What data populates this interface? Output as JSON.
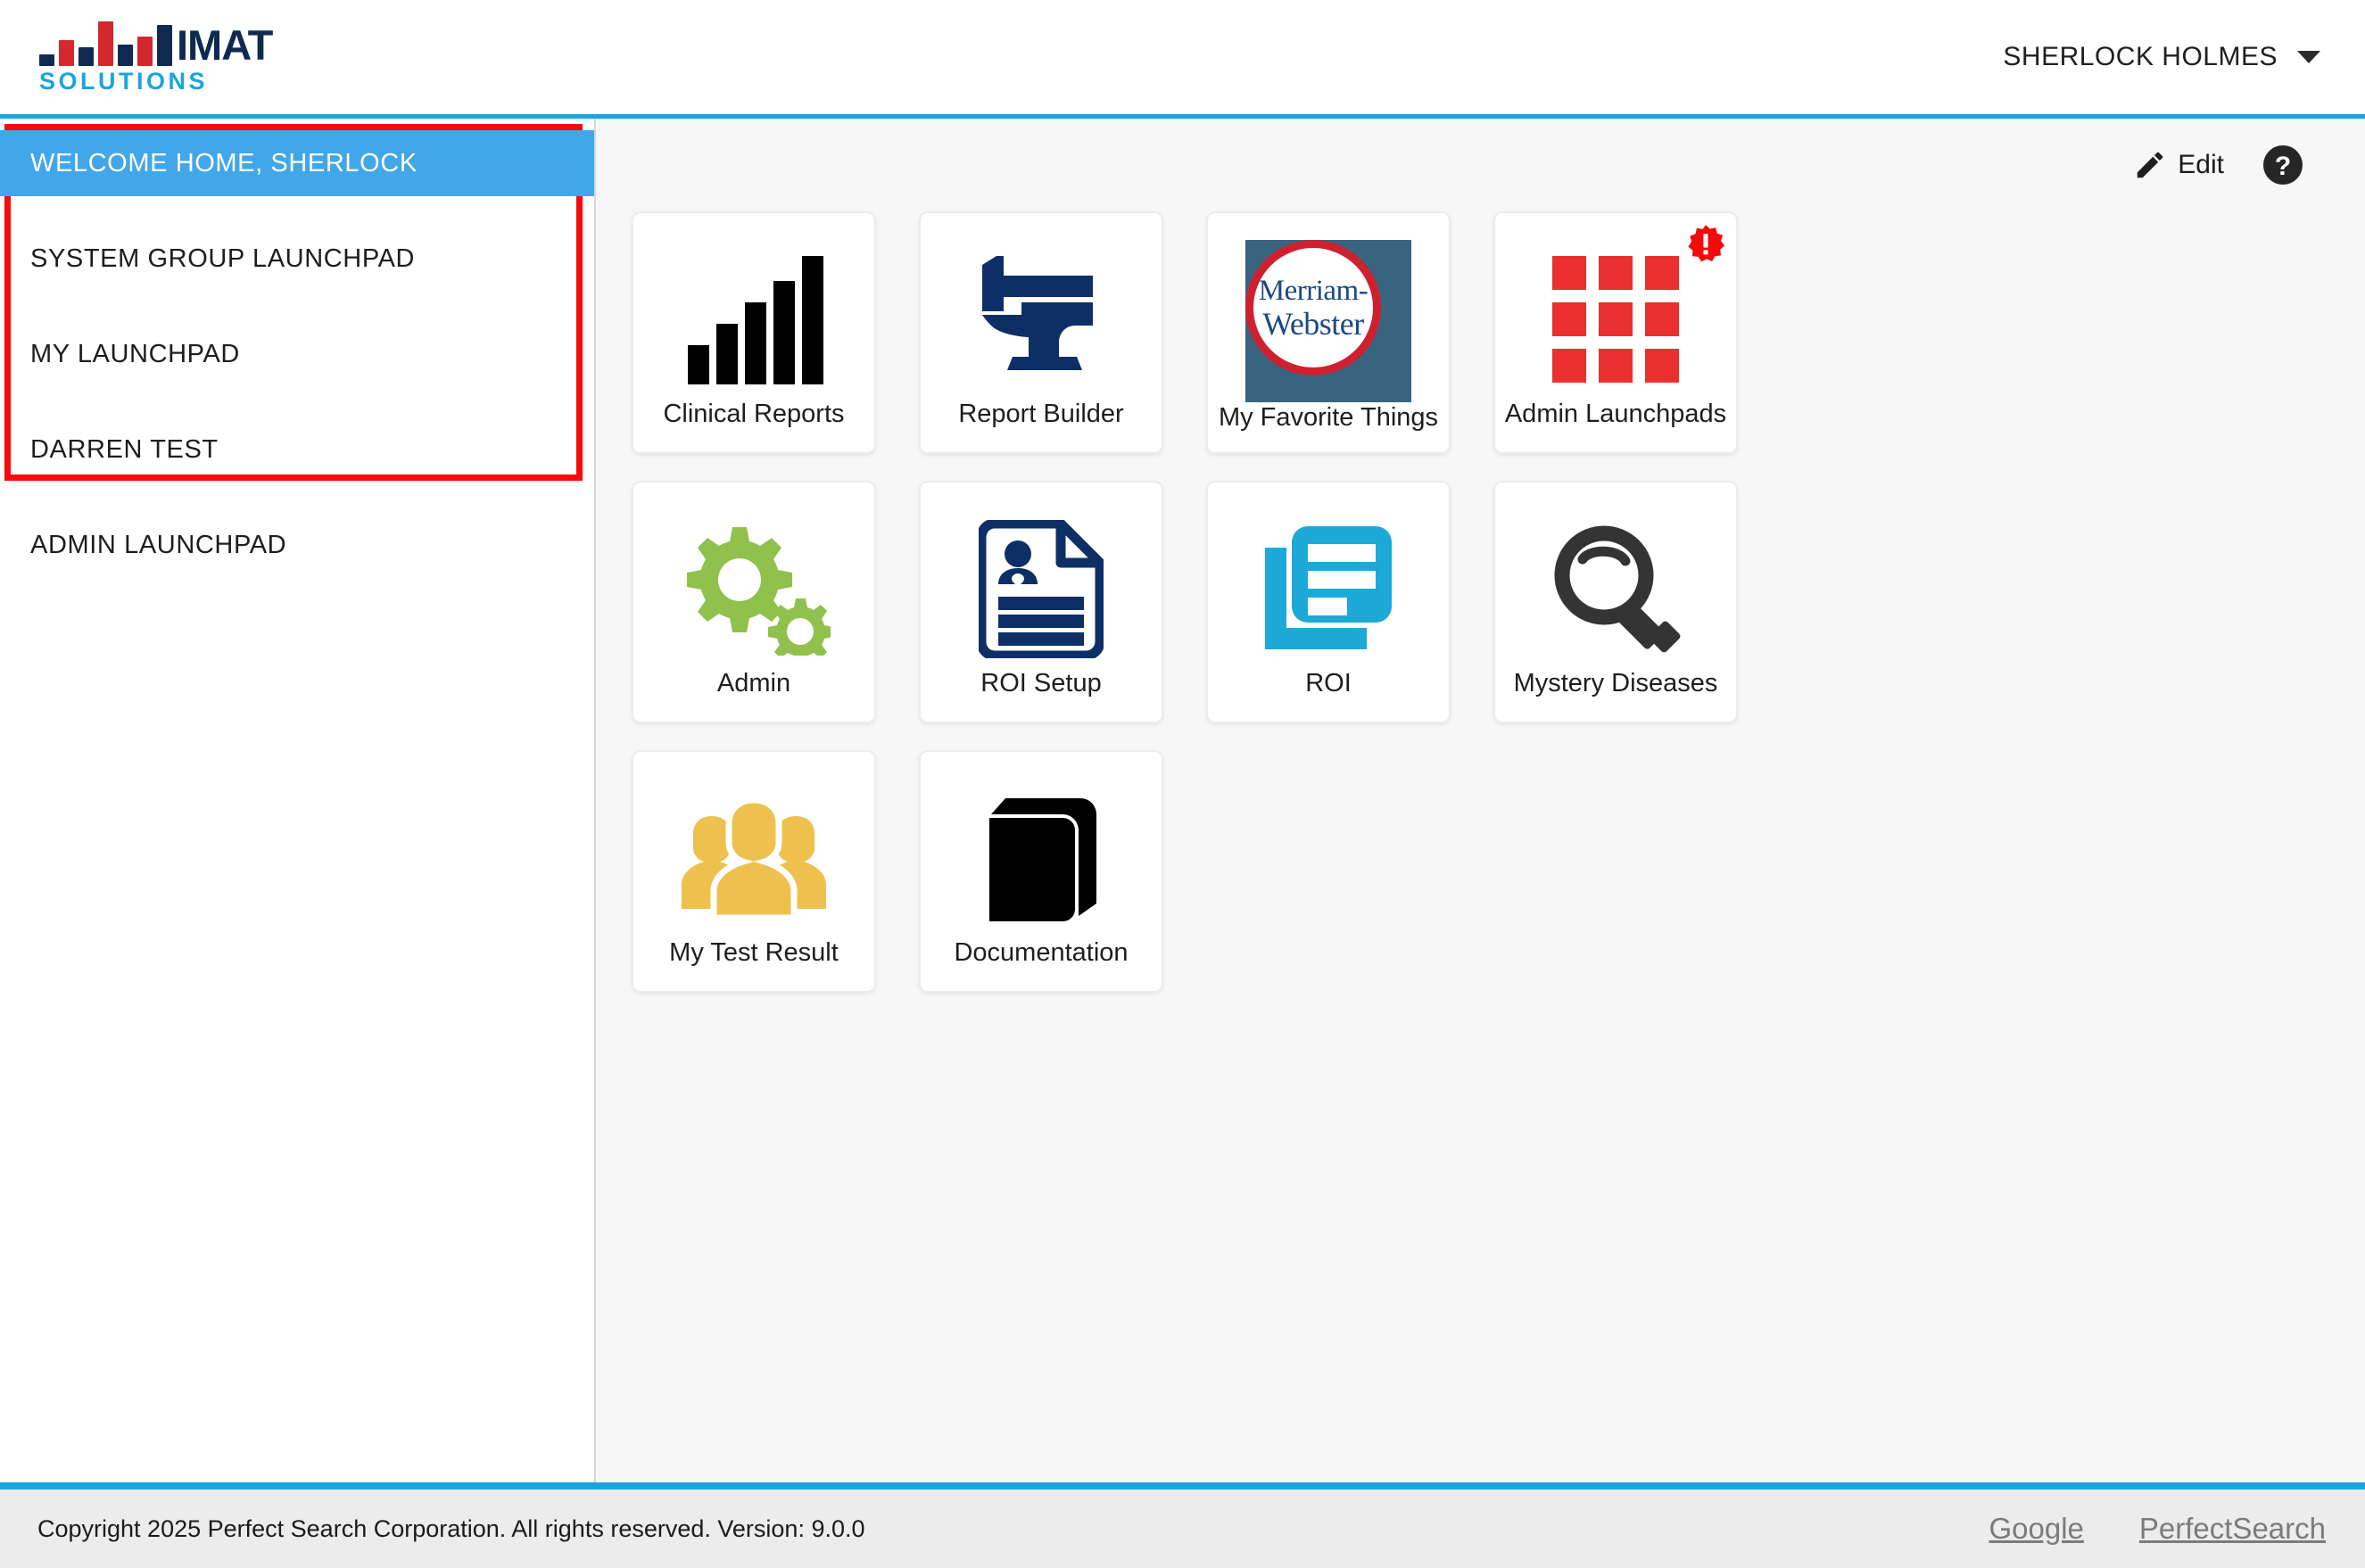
{
  "brand": {
    "name_primary": "IMAT",
    "name_secondary": "SOLUTIONS",
    "bar_colors": [
      "#0e2a50",
      "#d2282e",
      "#0e2a50",
      "#d2282e",
      "#0e2a50",
      "#d2282e",
      "#0e2a50"
    ],
    "accent_blue": "#1ba4de",
    "navy": "#0e2a50",
    "red": "#d2282e"
  },
  "header": {
    "user_name": "SHERLOCK HOLMES",
    "caret_icon": "chevron-down-icon"
  },
  "sidebar": {
    "highlight_outline_color": "#f60c0c",
    "active_color": "#42a7e8",
    "items": [
      {
        "label": "WELCOME HOME, SHERLOCK",
        "active": true
      },
      {
        "label": "SYSTEM GROUP LAUNCHPAD",
        "active": false
      },
      {
        "label": "MY LAUNCHPAD",
        "active": false
      },
      {
        "label": "DARREN TEST",
        "active": false
      },
      {
        "label": "ADMIN LAUNCHPAD",
        "active": false
      }
    ]
  },
  "toolbar": {
    "edit_label": "Edit",
    "edit_icon": "pencil-icon",
    "help_icon": "help-circle-icon"
  },
  "tiles": [
    {
      "label": "Clinical Reports",
      "icon": "bar-chart-icon",
      "badge": false,
      "color": "#000000"
    },
    {
      "label": "Report Builder",
      "icon": "anvil-hammer-icon",
      "badge": false,
      "color": "#0d2f66"
    },
    {
      "label": "My Favorite Things",
      "icon": "merriam-webster-logo",
      "badge": false,
      "color": "#39647f"
    },
    {
      "label": "Admin Launchpads",
      "icon": "grid-nine-squares-icon",
      "badge": true,
      "color": "#ea2f2f"
    },
    {
      "label": "Admin",
      "icon": "gears-icon",
      "badge": false,
      "color": "#90c14d"
    },
    {
      "label": "ROI Setup",
      "icon": "document-person-icon",
      "badge": false,
      "color": "#0d2f66"
    },
    {
      "label": "ROI",
      "icon": "stacked-documents-icon",
      "badge": false,
      "color": "#1ca9d8"
    },
    {
      "label": "Mystery Diseases",
      "icon": "magnifier-icon",
      "badge": false,
      "color": "#343434"
    },
    {
      "label": "My Test Result",
      "icon": "people-group-icon",
      "badge": false,
      "color": "#eec14f"
    },
    {
      "label": "Documentation",
      "icon": "book-icon",
      "badge": false,
      "color": "#000000"
    }
  ],
  "badge": {
    "icon": "alert-exclamation-badge-icon",
    "color": "#f50a0a"
  },
  "footer": {
    "copyright": "Copyright 2025 Perfect Search Corporation. All rights reserved. Version: 9.0.0",
    "links": [
      {
        "label": "Google"
      },
      {
        "label": "PerfectSearch"
      }
    ]
  }
}
